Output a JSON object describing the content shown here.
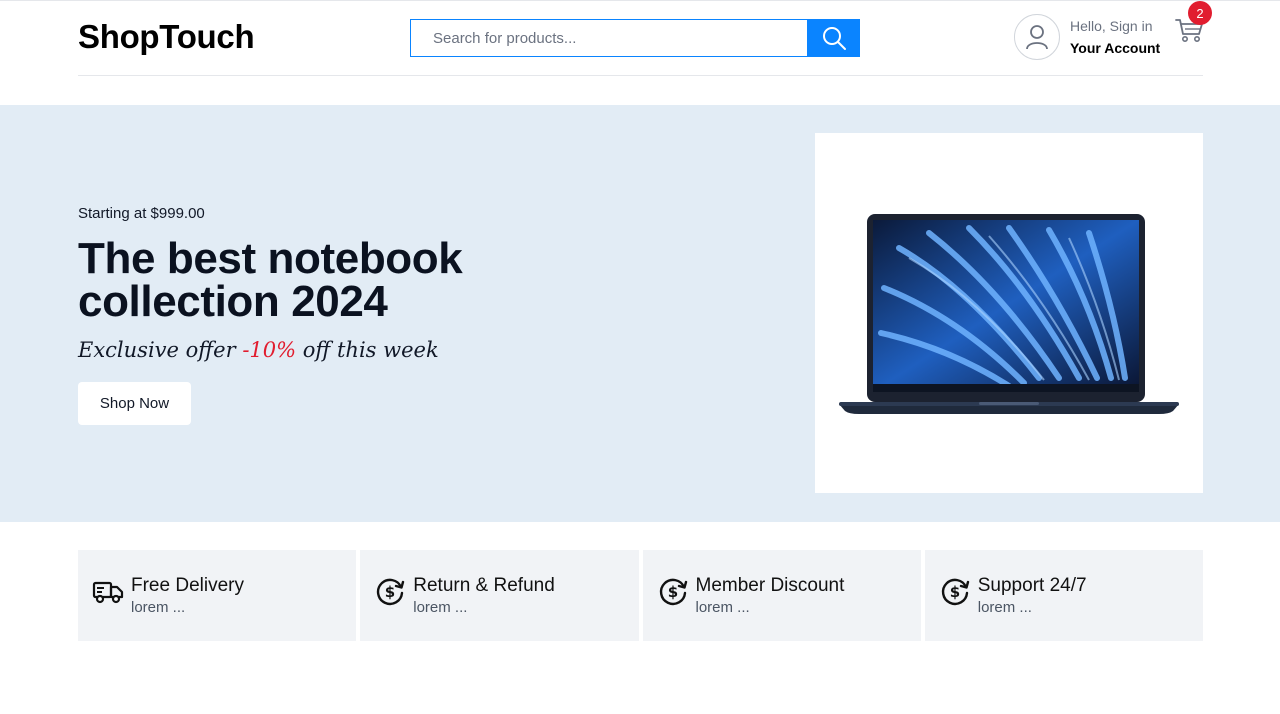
{
  "header": {
    "logo": "ShopTouch",
    "search": {
      "placeholder": "Search for products..."
    },
    "account": {
      "greeting": "Hello, Sign in",
      "title": "Your Account"
    },
    "cart": {
      "count": "2"
    }
  },
  "hero": {
    "starting_at": "Starting at $999.00",
    "title": "The best notebook collection 2024",
    "offer_prefix": "Exclusive offer",
    "offer_percent": "-10%",
    "offer_suffix": "off this week",
    "cta": "Shop Now"
  },
  "features": [
    {
      "icon": "delivery-truck-icon",
      "title": "Free Delivery",
      "subtitle": "lorem ..."
    },
    {
      "icon": "dollar-cycle-icon",
      "title": "Return & Refund",
      "subtitle": "lorem ..."
    },
    {
      "icon": "dollar-cycle-icon",
      "title": "Member Discount",
      "subtitle": "lorem ..."
    },
    {
      "icon": "dollar-cycle-icon",
      "title": "Support 24/7",
      "subtitle": "lorem ..."
    }
  ],
  "colors": {
    "accent": "#0a84ff",
    "badge": "#e11d2f",
    "hero_bg": "#e2ecf5",
    "feature_bg": "#f1f3f6"
  }
}
